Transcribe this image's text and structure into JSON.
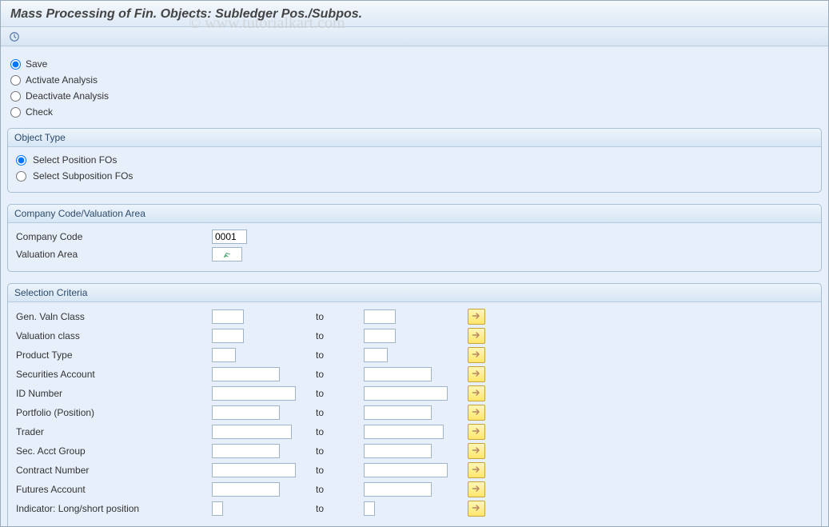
{
  "title": "Mass Processing of Fin. Objects: Subledger Pos./Subpos.",
  "watermark": "© www.tutorialkart.com",
  "top_options": {
    "save": "Save",
    "activate": "Activate Analysis",
    "deactivate": "Deactivate Analysis",
    "check": "Check"
  },
  "object_type": {
    "header": "Object Type",
    "position": "Select Position FOs",
    "subposition": "Select Subposition FOs"
  },
  "company": {
    "header": "Company Code/Valuation Area",
    "code_label": "Company Code",
    "code_value": "0001",
    "valarea_label": "Valuation Area"
  },
  "selection": {
    "header": "Selection Criteria",
    "to": "to",
    "rows": [
      {
        "label": "Gen. Valn Class",
        "w1": 40,
        "w2": 40
      },
      {
        "label": "Valuation class",
        "w1": 40,
        "w2": 40
      },
      {
        "label": "Product Type",
        "w1": 30,
        "w2": 30
      },
      {
        "label": "Securities Account",
        "w1": 85,
        "w2": 85
      },
      {
        "label": "ID Number",
        "w1": 105,
        "w2": 105
      },
      {
        "label": "Portfolio (Position)",
        "w1": 85,
        "w2": 85
      },
      {
        "label": "Trader",
        "w1": 100,
        "w2": 100
      },
      {
        "label": "Sec. Acct Group",
        "w1": 85,
        "w2": 85
      },
      {
        "label": "Contract Number",
        "w1": 105,
        "w2": 105
      },
      {
        "label": "Futures Account",
        "w1": 85,
        "w2": 85
      },
      {
        "label": "Indicator: Long/short position",
        "w1": 14,
        "w2": 14
      }
    ]
  }
}
